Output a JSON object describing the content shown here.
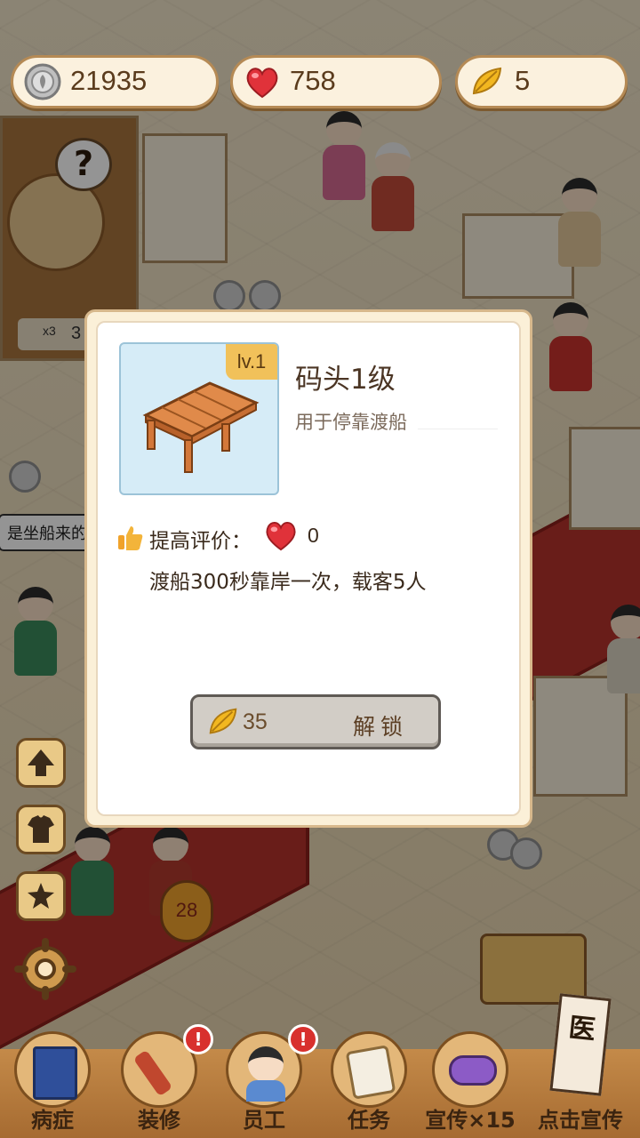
{
  "resources": {
    "coins": "21935",
    "hearts": "758",
    "leaves": "5"
  },
  "scene": {
    "speech_bubble": "是坐船来的",
    "side_item_count": "3",
    "side_item_multiplier": "x3",
    "lantern_number": "28"
  },
  "dialog": {
    "level_badge": "lv.1",
    "title": "码头1级",
    "description": "用于停靠渡船",
    "rating_label": "提高评价：",
    "rating_value": "0",
    "effect_text": "渡船300秒靠岸一次，载客5人",
    "unlock_cost": "35",
    "unlock_label": "解锁"
  },
  "nav": [
    {
      "label": "病症",
      "icon": "book-icon",
      "alert": false
    },
    {
      "label": "装修",
      "icon": "brush-icon",
      "alert": true
    },
    {
      "label": "员工",
      "icon": "staff-icon",
      "alert": true
    },
    {
      "label": "任务",
      "icon": "scroll-icon",
      "alert": false
    },
    {
      "label": "宣传×15",
      "icon": "flyer-icon",
      "alert": false
    },
    {
      "label": "点击宣传",
      "icon": "hospital-sign-icon",
      "alert": false
    }
  ],
  "colors": {
    "accent": "#f1c15a",
    "heart": "#e0323a",
    "leaf": "#f2b720",
    "panel": "#fbf0d8"
  }
}
